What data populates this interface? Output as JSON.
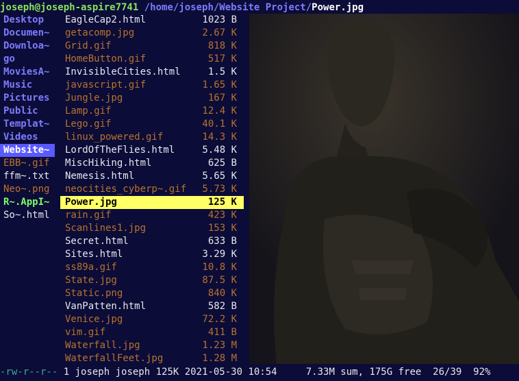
{
  "titlebar": {
    "host": "joseph@joseph-aspire7741",
    "path": "/home/joseph/Website Project/",
    "file": "Power.jpg"
  },
  "left_pane": [
    {
      "label": "Desktop",
      "kind": "dir"
    },
    {
      "label": "Documen~",
      "kind": "dir"
    },
    {
      "label": "Downloa~",
      "kind": "dir"
    },
    {
      "label": "go",
      "kind": "dir"
    },
    {
      "label": "MoviesA~",
      "kind": "dir"
    },
    {
      "label": "Music",
      "kind": "dir"
    },
    {
      "label": "Pictures",
      "kind": "dir"
    },
    {
      "label": "Public",
      "kind": "dir"
    },
    {
      "label": "Templat~",
      "kind": "dir"
    },
    {
      "label": "Videos",
      "kind": "dir"
    },
    {
      "label": "Website~",
      "kind": "cur"
    },
    {
      "label": "EBB~.gif",
      "kind": "dimfile"
    },
    {
      "label": "ffm~.txt",
      "kind": "whitefile"
    },
    {
      "label": "Neo~.png",
      "kind": "dimfile"
    },
    {
      "label": "R~.AppI~",
      "kind": "exec"
    },
    {
      "label": "So~.html",
      "kind": "whitefile"
    }
  ],
  "files": [
    {
      "name": "EagleCap2.html",
      "size": "1023 B",
      "style": "white"
    },
    {
      "name": "getacomp.jpg",
      "size": "2.67 K",
      "style": "dim"
    },
    {
      "name": "Grid.gif",
      "size": "818 K",
      "style": "dim"
    },
    {
      "name": "HomeButton.gif",
      "size": "517 K",
      "style": "dim"
    },
    {
      "name": "InvisibleCities.html",
      "size": "1.5 K",
      "style": "white"
    },
    {
      "name": "javascript.gif",
      "size": "1.65 K",
      "style": "dim"
    },
    {
      "name": "Jungle.jpg",
      "size": "167 K",
      "style": "dim"
    },
    {
      "name": "Lamp.gif",
      "size": "12.4 K",
      "style": "dim"
    },
    {
      "name": "Lego.gif",
      "size": "40.1 K",
      "style": "dim"
    },
    {
      "name": "linux_powered.gif",
      "size": "14.3 K",
      "style": "dim"
    },
    {
      "name": "LordOfTheFlies.html",
      "size": "5.48 K",
      "style": "white"
    },
    {
      "name": "MiscHiking.html",
      "size": "625 B",
      "style": "white"
    },
    {
      "name": "Nemesis.html",
      "size": "5.65 K",
      "style": "white"
    },
    {
      "name": "neocities_cyberp~.gif",
      "size": "5.73 K",
      "style": "dim"
    },
    {
      "name": "Power.jpg",
      "size": "125 K",
      "style": "sel"
    },
    {
      "name": "rain.gif",
      "size": "423 K",
      "style": "dim"
    },
    {
      "name": "Scanlines1.jpg",
      "size": "153 K",
      "style": "dim"
    },
    {
      "name": "Secret.html",
      "size": "633 B",
      "style": "white"
    },
    {
      "name": "Sites.html",
      "size": "3.29 K",
      "style": "white"
    },
    {
      "name": "ss89a.gif",
      "size": "10.8 K",
      "style": "dim"
    },
    {
      "name": "State.jpg",
      "size": "87.5 K",
      "style": "dim"
    },
    {
      "name": "Static.png",
      "size": "840 K",
      "style": "dim"
    },
    {
      "name": "VanPatten.html",
      "size": "582 B",
      "style": "white"
    },
    {
      "name": "Venice.jpg",
      "size": "72.2 K",
      "style": "dim"
    },
    {
      "name": "vim.gif",
      "size": "411 B",
      "style": "dim"
    },
    {
      "name": "Waterfall.jpg",
      "size": "1.23 M",
      "style": "dim"
    },
    {
      "name": "WaterfallFeet.jpg",
      "size": "1.28 M",
      "style": "dim"
    }
  ],
  "statusbar": {
    "permissions": "-rw-r--r--",
    "info": " 1 joseph joseph 125K 2021-05-30 10:54     7.33M sum, 175G free  26/39  92%"
  },
  "colors": {
    "background": "#0c0c38",
    "directory": "#7c7cff",
    "selection": "#ffff66",
    "image_file": "#b8732e"
  }
}
